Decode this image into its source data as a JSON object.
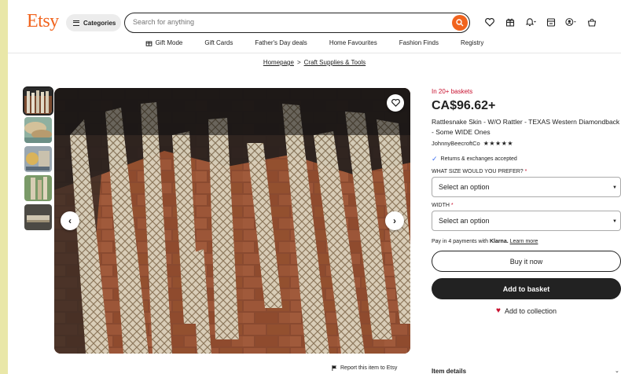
{
  "header": {
    "logo": "Etsy",
    "categories_label": "Categories",
    "search_placeholder": "Search for anything"
  },
  "nav": [
    {
      "label": "Gift Mode",
      "icon": "gift-icon"
    },
    {
      "label": "Gift Cards"
    },
    {
      "label": "Father's Day deals"
    },
    {
      "label": "Home Favourites"
    },
    {
      "label": "Fashion Finds"
    },
    {
      "label": "Registry"
    }
  ],
  "breadcrumb": [
    "Homepage",
    "Craft Supplies & Tools"
  ],
  "product": {
    "baskets": "In 20+ baskets",
    "price": "CA$96.62+",
    "title": "Rattlesnake Skin - W/O Rattler - TEXAS Western Diamondback - Some WIDE Ones",
    "shop": "JohnnyBeecroftCo",
    "stars": "★★★★★",
    "rating": 5,
    "returns": "Returns & exchanges accepted",
    "size_label": "What size would you prefer?",
    "size_value": "Select an option",
    "width_label": "Width",
    "width_value": "Select an option",
    "pay_text": "Pay in 4 payments with",
    "pay_brand": "Klarna.",
    "pay_link": "Learn more",
    "buy_now": "Buy it now",
    "add_basket": "Add to basket",
    "add_collection": "Add to collection",
    "report": "Report this item to Etsy",
    "item_details": "Item details"
  },
  "colors": {
    "brand": "#f1641e",
    "alert": "#c8102e",
    "dark_button": "#222222",
    "backdrop": "#e9e7a8"
  }
}
